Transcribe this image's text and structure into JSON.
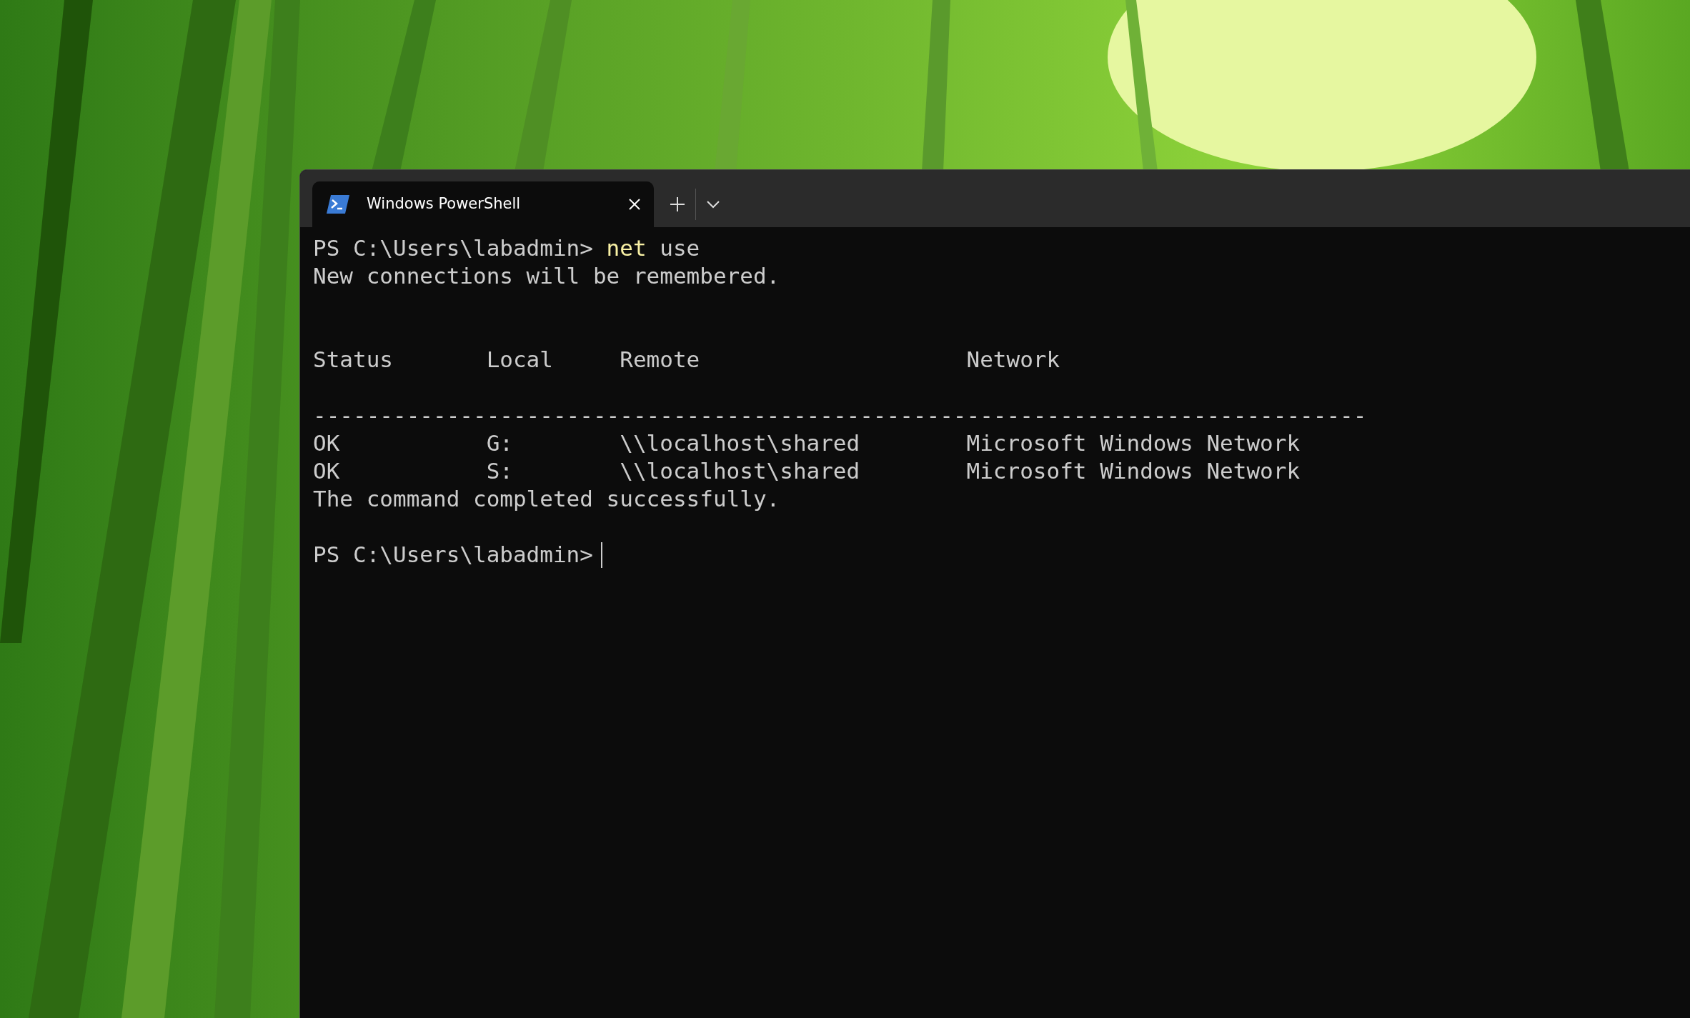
{
  "tab": {
    "title": "Windows PowerShell",
    "selected": true
  },
  "terminal": {
    "command": {
      "prompt": "PS C:\\Users\\labadmin>",
      "name": "net",
      "args": "use"
    },
    "message": "New connections will be remembered.",
    "table": {
      "columns": [
        "Status",
        "Local",
        "Remote",
        "Network"
      ],
      "separator": "-------------------------------------------------------------------------------",
      "rows": [
        [
          "OK",
          "G:",
          "\\\\localhost\\shared",
          "Microsoft Windows Network"
        ],
        [
          "OK",
          "S:",
          "\\\\localhost\\shared",
          "Microsoft Windows Network"
        ]
      ]
    },
    "result": "The command completed successfully.",
    "prompt": "PS C:\\Users\\labadmin>"
  }
}
